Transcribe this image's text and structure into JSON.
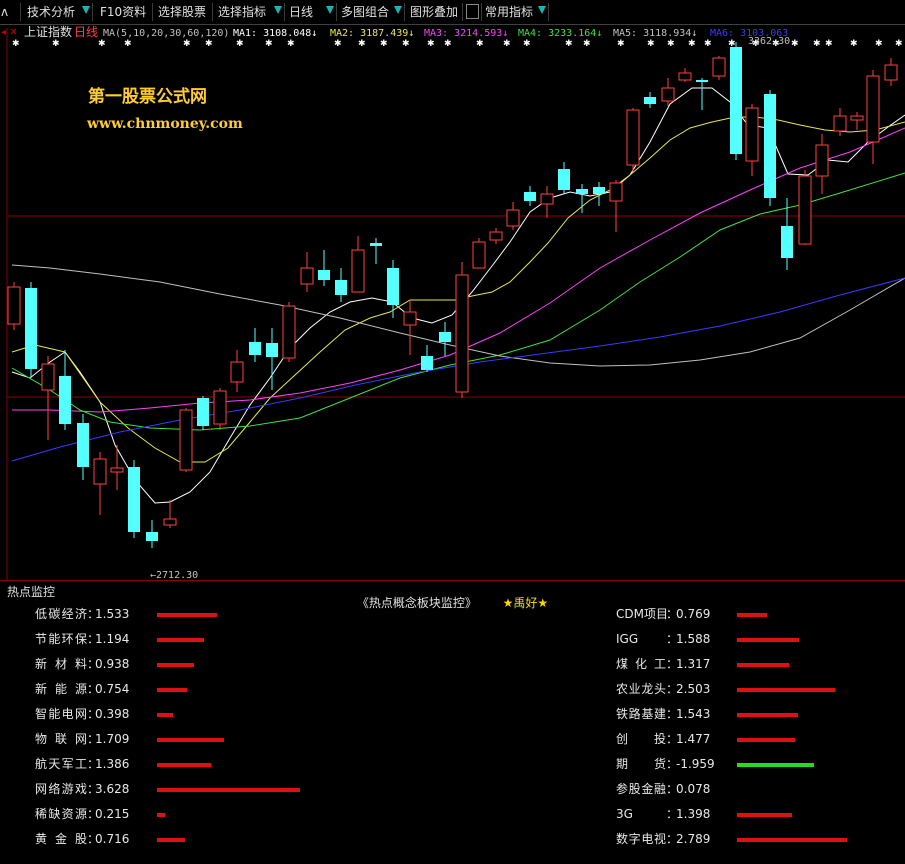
{
  "toolbar": {
    "items": [
      "技术分析",
      "F10资料",
      "选择股票",
      "选择指标",
      "日线",
      "多图组合",
      "图形叠加",
      "常用指标"
    ],
    "accent_color": "#19b5b5"
  },
  "chart": {
    "index_name": "上证指数",
    "period": "日线",
    "ma_params": "MA(5,10,20,30,60,120)",
    "ma_labels": [
      {
        "label": "MA1: 3108.048",
        "arrow": "↓",
        "color": "#ffffff"
      },
      {
        "label": "MA2: 3187.439",
        "arrow": "↓",
        "color": "#e8e84a"
      },
      {
        "label": "MA3: 3214.593",
        "arrow": "↓",
        "color": "#ff40ff"
      },
      {
        "label": "MA4: 3233.164",
        "arrow": "↓",
        "color": "#40e040"
      },
      {
        "label": "MA5: 3118.934",
        "arrow": "↓",
        "color": "#c0c0c0"
      },
      {
        "label": "MA6: 3103.063",
        "arrow": "",
        "color": "#3a3aff"
      }
    ],
    "watermark_title": "第一股票公式网",
    "watermark_url": "www.chnmoney.com",
    "low_marker": "←2712.30",
    "high_marker": "3362.30",
    "up_color": "#ff4040",
    "down_color": "#54ffff"
  },
  "hot_panel": {
    "title": "热点监控",
    "heading": "《热点概念板块监控》",
    "heading_badge": "★禹好★",
    "left": [
      {
        "name": "低碳经济",
        "value": "1.533"
      },
      {
        "name": "节能环保",
        "value": "1.194"
      },
      {
        "name": "新材料",
        "value": "0.938"
      },
      {
        "name": "新能源",
        "value": "0.754"
      },
      {
        "name": "智能电网",
        "value": "0.398"
      },
      {
        "name": "物联网",
        "value": "1.709"
      },
      {
        "name": "航天军工",
        "value": "1.386"
      },
      {
        "name": "网络游戏",
        "value": "3.628"
      },
      {
        "name": "稀缺资源",
        "value": "0.215"
      },
      {
        "name": "黄金股",
        "value": "0.716"
      }
    ],
    "right": [
      {
        "name": "CDM项目",
        "value": "0.769"
      },
      {
        "name": "IGG",
        "value": "1.588"
      },
      {
        "name": "煤化工",
        "value": "1.317"
      },
      {
        "name": "农业龙头",
        "value": "2.503"
      },
      {
        "name": "铁路基建",
        "value": "1.543"
      },
      {
        "name": "创投",
        "value": "1.477"
      },
      {
        "name": "期货",
        "value": "-1.959"
      },
      {
        "name": "参股金融",
        "value": "0.078"
      },
      {
        "name": "3G",
        "value": "1.398"
      },
      {
        "name": "数字电视",
        "value": "2.789"
      }
    ],
    "positive_color": "#dd1111",
    "negative_color": "#22dd22"
  }
}
